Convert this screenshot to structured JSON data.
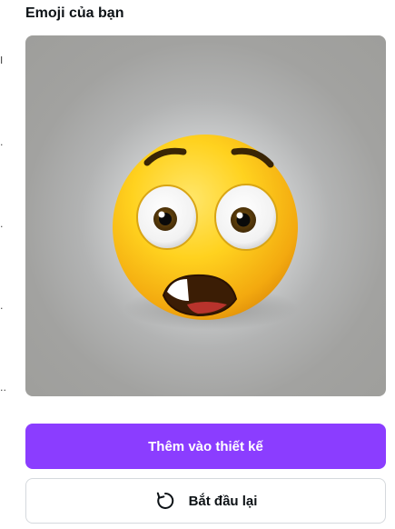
{
  "panel": {
    "title": "Emoji của bạn"
  },
  "preview": {
    "emoji_icon": "anxious-face-emoji",
    "colors": {
      "background": "#a3a3a0",
      "face": "#ffd21f"
    }
  },
  "actions": {
    "add_to_design_label": "Thêm vào thiết kế",
    "start_over_label": "Bắt đầu lại",
    "start_over_icon": "refresh-icon",
    "primary_color": "#8b3dff"
  },
  "left_strip": {
    "glyphs": [
      "I",
      ".",
      ".",
      ".",
      ".."
    ]
  }
}
